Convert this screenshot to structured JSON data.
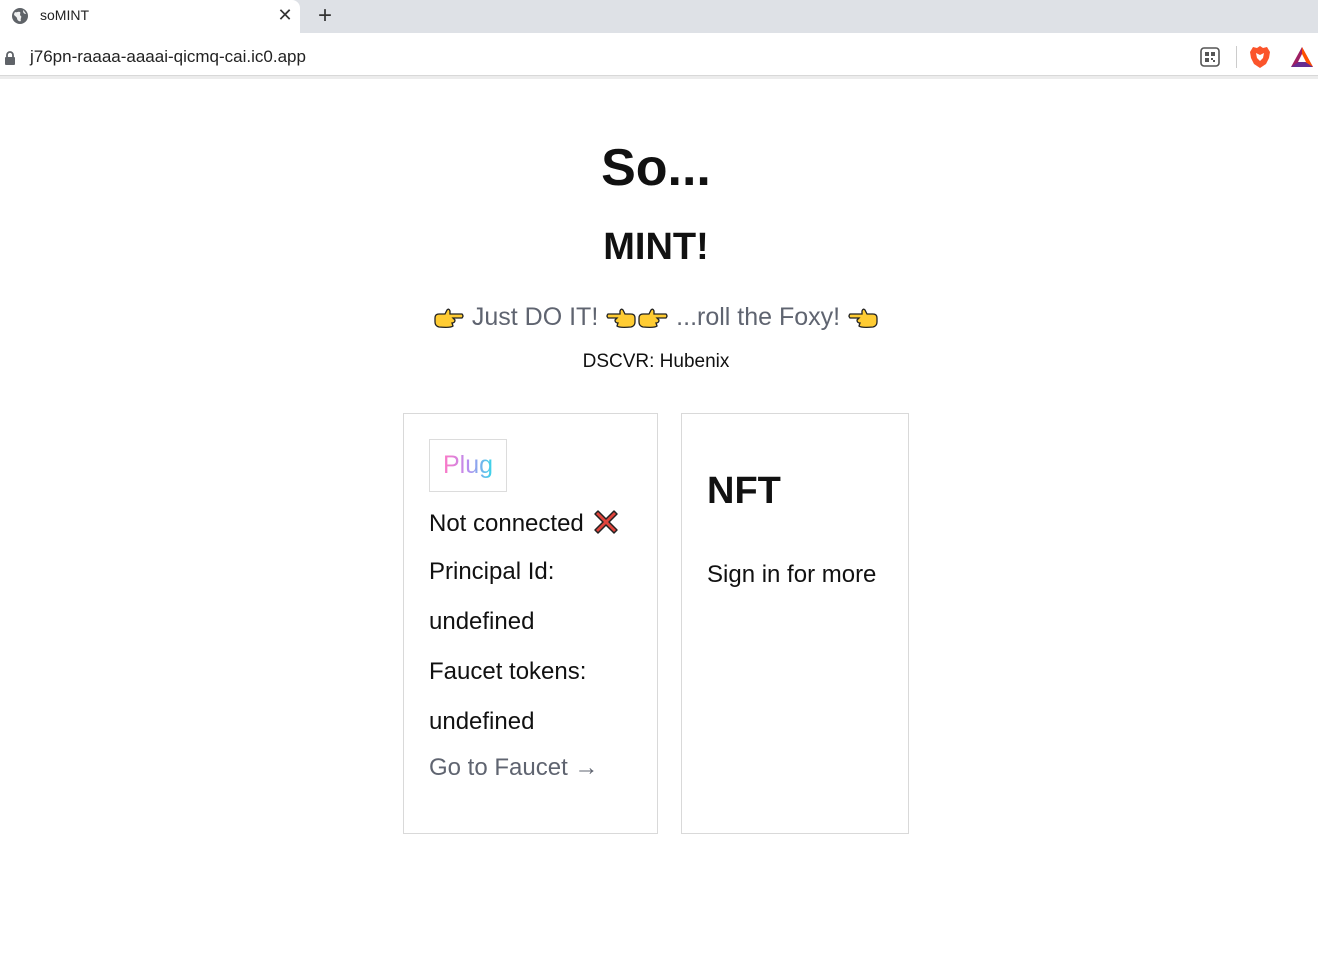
{
  "browser": {
    "tab_title": "soMINT",
    "close_glyph": "✕",
    "new_tab_glyph": "+",
    "url": "j76pn-raaaa-aaaai-qicmq-cai.ic0.app"
  },
  "page": {
    "title": "So...",
    "subtitle": "MINT!",
    "tagline_left": "Just DO IT!",
    "tagline_right": "...roll the Foxy!",
    "dscvr": "DSCVR: Hubenix"
  },
  "wallet_card": {
    "plug_label": "Plug",
    "status": "Not connected",
    "principal_label": "Principal Id:",
    "principal_value": "undefined",
    "faucet_label": "Faucet tokens:",
    "faucet_value": "undefined",
    "faucet_link": "Go to Faucet →"
  },
  "nft_card": {
    "title": "NFT",
    "message": "Sign in for more"
  },
  "colors": {
    "accent_gray": "#5f6470",
    "plug_gradient": [
      "#ff78c4",
      "#b98cf0",
      "#36d7e8"
    ],
    "brave_orange": "#fb542b",
    "x_red": "#e0443c"
  },
  "icons": [
    "globe-icon",
    "close-icon",
    "plus-icon",
    "lock-icon",
    "qr-code-icon",
    "brave-lion-icon",
    "bat-triangle-icon",
    "pointing-right-icon",
    "pointing-left-icon",
    "cross-mark-icon"
  ]
}
